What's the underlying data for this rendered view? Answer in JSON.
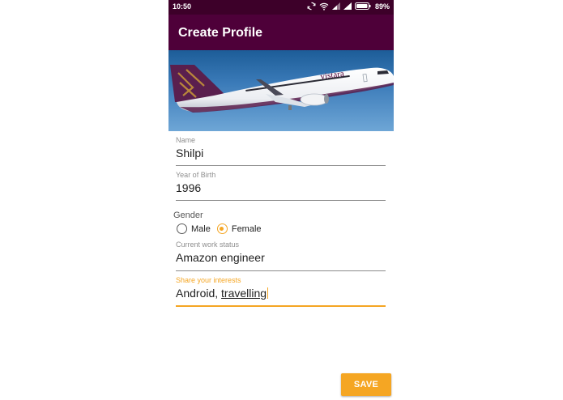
{
  "status_bar": {
    "time": "10:50",
    "battery": "89%",
    "icons": [
      "sync-icon",
      "wifi-icon",
      "signal-icon",
      "signal-icon",
      "battery-icon"
    ]
  },
  "app_bar": {
    "title": "Create Profile"
  },
  "hero_image": {
    "airline_text": "vistara"
  },
  "form": {
    "name": {
      "label": "Name",
      "value": "Shilpi"
    },
    "year_of_birth": {
      "label": "Year of Birth",
      "value": "1996"
    },
    "gender": {
      "label": "Gender",
      "options": [
        "Male",
        "Female"
      ],
      "selected": "Female"
    },
    "work_status": {
      "label": "Current work status",
      "value": "Amazon engineer"
    },
    "interests": {
      "label": "Share your interests",
      "value_part1": "Android, ",
      "value_part2": "travelling",
      "focused": true
    }
  },
  "save_button": {
    "label": "SAVE"
  },
  "colors": {
    "status_bar": "#3d0029",
    "app_bar": "#4e0039",
    "accent": "#f5a623"
  }
}
